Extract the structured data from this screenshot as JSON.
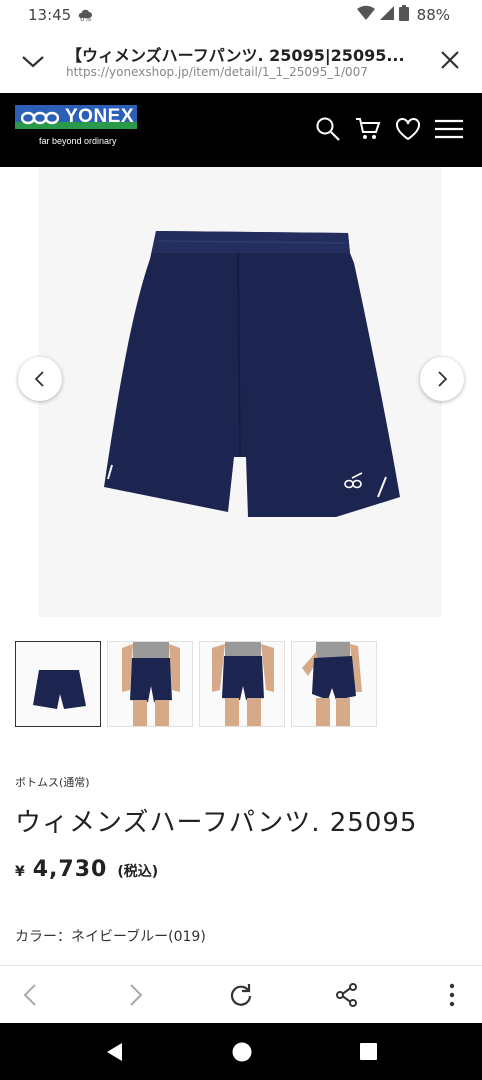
{
  "status_bar": {
    "time": "13:45",
    "data_saver": "0%",
    "battery": "88%"
  },
  "tab_bar": {
    "title": "【ウィメンズハーフパンツ. 25095|25095...",
    "url": "https://yonexshop.jp/item/detail/1_1_25095_1/007"
  },
  "site_header": {
    "brand": "YONEX",
    "tagline": "far beyond ordinary",
    "icons": [
      "search-icon",
      "cart-icon",
      "heart-icon",
      "menu-icon"
    ]
  },
  "gallery": {
    "thumbnail_count": 4,
    "active_thumbnail": 1
  },
  "product": {
    "category": "ボトムス(通常)",
    "name": "ウィメンズハーフパンツ. 25095",
    "price_symbol": "¥",
    "price": "4,730",
    "tax_note": "(税込)",
    "color_label": "カラー：ネイビーブルー(019)"
  },
  "colors": {
    "navy": "#1c2550",
    "header_bg": "#000000",
    "logo_blue": "#2c5fb8",
    "logo_green": "#2a9a4a"
  }
}
